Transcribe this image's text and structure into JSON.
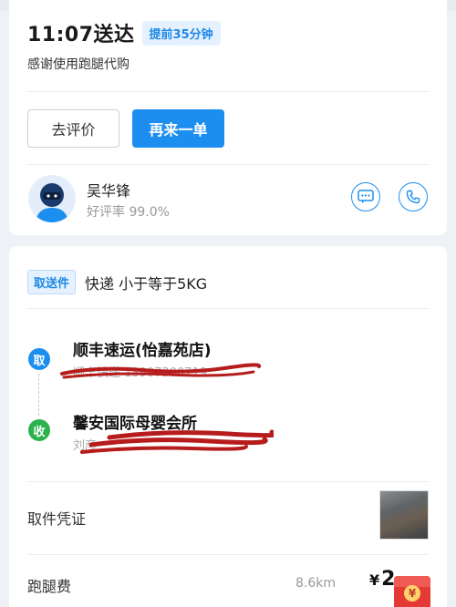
{
  "order": {
    "eta_text": "11:07送达",
    "early_badge": "提前35分钟",
    "thanks_text": "感谢使用跑腿代购"
  },
  "actions": {
    "rate_label": "去评价",
    "reorder_label": "再来一单"
  },
  "rider": {
    "name": "吴华锋",
    "rating": "好评率 99.0%",
    "avatar_icon": "rider-avatar-icon",
    "message_icon": "message-icon",
    "phone_icon": "phone-icon"
  },
  "service": {
    "badge": "取送件",
    "title": "快递 小于等于5KG"
  },
  "pickup": {
    "dot_label": "取",
    "name": "顺丰速运(怡嘉苑店)",
    "sub": "顺丰快递 13907300719"
  },
  "dropoff": {
    "dot_label": "收",
    "name": "馨安国际母婴会所",
    "sub": "刘彦"
  },
  "voucher": {
    "label": "取件凭证"
  },
  "fee": {
    "label": "跑腿费",
    "distance": "8.6km",
    "currency": "¥",
    "amount": "2"
  },
  "colors": {
    "accent": "#1c8ef0",
    "pickup": "#1c8ef0",
    "dropoff": "#2bb24c",
    "redaction": "#b71c1c"
  }
}
